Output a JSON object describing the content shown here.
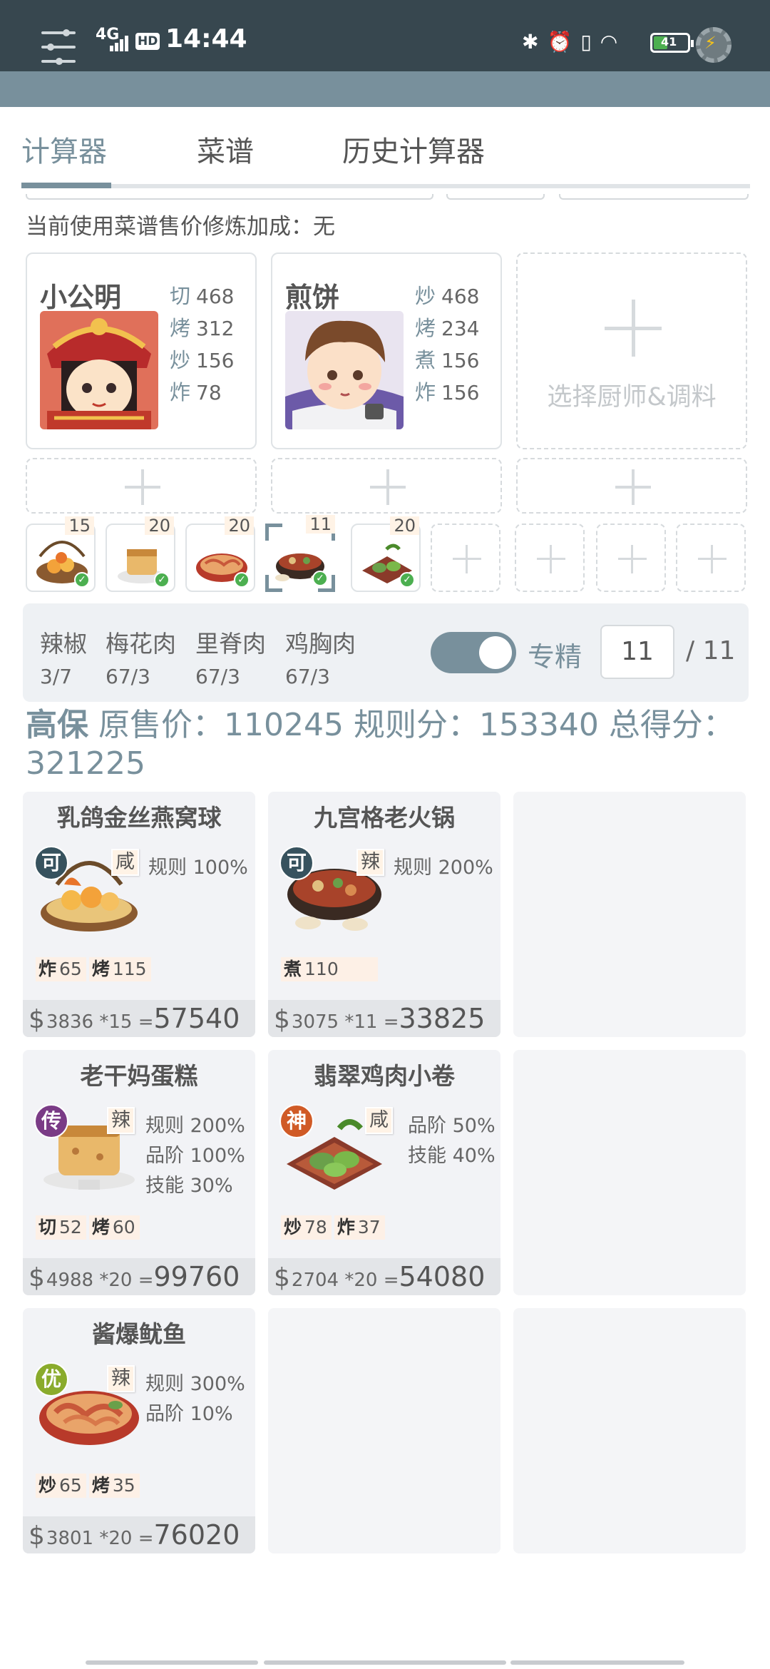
{
  "status": {
    "network": "4G",
    "hd": "HD",
    "time": "14:44",
    "battery": "41",
    "battery_level": 0.41
  },
  "tabs": [
    {
      "label": "计算器",
      "active": true
    },
    {
      "label": "菜谱",
      "active": false
    },
    {
      "label": "历史计算器",
      "active": false
    }
  ],
  "bonus_text": "当前使用菜谱售价修炼加成：无",
  "chefs": [
    {
      "name": "小公明",
      "stats": [
        {
          "k": "切",
          "v": "468"
        },
        {
          "k": "烤",
          "v": "312"
        },
        {
          "k": "炒",
          "v": "156"
        },
        {
          "k": "炸",
          "v": "78"
        }
      ]
    },
    {
      "name": "煎饼",
      "stats": [
        {
          "k": "炒",
          "v": "468"
        },
        {
          "k": "烤",
          "v": "234"
        },
        {
          "k": "煮",
          "v": "156"
        },
        {
          "k": "炸",
          "v": "156"
        }
      ]
    }
  ],
  "select_chef_label": "选择厨师&调料",
  "dish_slots": [
    "15",
    "20",
    "20",
    "11",
    "20"
  ],
  "materials": [
    {
      "name": "辣椒",
      "qty": "3/7"
    },
    {
      "name": "梅花肉",
      "qty": "67/3"
    },
    {
      "name": "里脊肉",
      "qty": "67/3"
    },
    {
      "name": "鸡胸肉",
      "qty": "67/3"
    }
  ],
  "specialize": {
    "label": "专精",
    "value": "11",
    "max": "/ 11",
    "on": true
  },
  "summary": {
    "chef": "高保",
    "text": "原售价：110245 规则分：153340 总得分：321225"
  },
  "dishes": [
    {
      "name": "乳鸽金丝燕窝球",
      "grade": "可",
      "flavor": "咸",
      "rules": [
        "规则 100%"
      ],
      "skills": [
        {
          "k": "炸",
          "v": "65"
        },
        {
          "k": "烤",
          "v": "115"
        }
      ],
      "price": "3836 *15",
      "total": "57540"
    },
    {
      "name": "九宫格老火锅",
      "grade": "可",
      "flavor": "辣",
      "rules": [
        "规则 200%"
      ],
      "skills": [
        {
          "k": "煮",
          "v": "110"
        }
      ],
      "price": "3075 *11",
      "total": "33825"
    },
    {
      "name": "老干妈蛋糕",
      "grade": "传",
      "flavor": "辣",
      "rules": [
        "规则 200%",
        "品阶 100%",
        "技能 30%"
      ],
      "skills": [
        {
          "k": "切",
          "v": "52"
        },
        {
          "k": "烤",
          "v": "60"
        }
      ],
      "price": "4988 *20",
      "total": "99760"
    },
    {
      "name": "翡翠鸡肉小卷",
      "grade": "神",
      "flavor": "咸",
      "rules": [
        "品阶 50%",
        "技能 40%"
      ],
      "skills": [
        {
          "k": "炒",
          "v": "78"
        },
        {
          "k": "炸",
          "v": "37"
        }
      ],
      "price": "2704 *20",
      "total": "54080"
    },
    {
      "name": "酱爆鱿鱼",
      "grade": "优",
      "flavor": "辣",
      "rules": [
        "规则 300%",
        "品阶 10%"
      ],
      "skills": [
        {
          "k": "炒",
          "v": "65"
        },
        {
          "k": "烤",
          "v": "35"
        }
      ],
      "price": "3801 *20",
      "total": "76020"
    }
  ],
  "colors": {
    "accent": "#78909c",
    "status_bar": "#37474f"
  }
}
